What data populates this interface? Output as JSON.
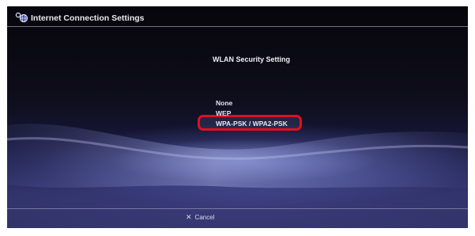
{
  "header": {
    "title": "Internet Connection Settings",
    "icon": "network-settings-icon"
  },
  "main": {
    "heading": "WLAN Security Setting",
    "options": [
      "None",
      "WEP",
      "WPA-PSK / WPA2-PSK"
    ],
    "selected_option": "WPA-PSK / WPA2-PSK"
  },
  "footer": {
    "cancel_icon": "cross-button-icon",
    "cancel_label": "Cancel"
  },
  "colors": {
    "highlight_border": "#e0101e",
    "text": "#e6e6ee"
  }
}
